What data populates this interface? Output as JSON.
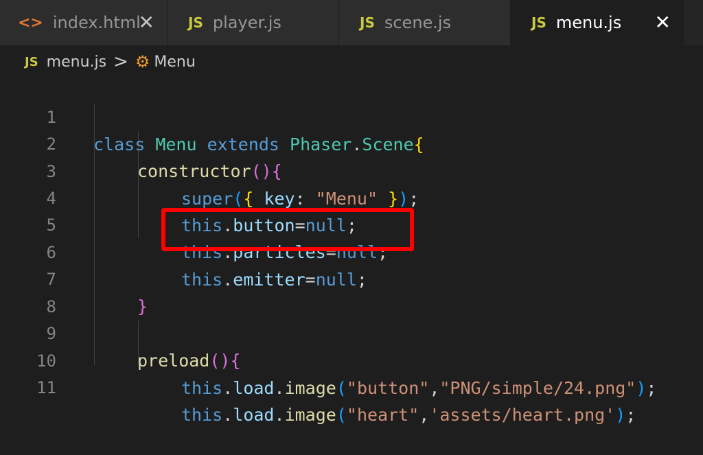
{
  "tabs": [
    {
      "icon": "html-icon",
      "glyph": "<>",
      "label": "index.html",
      "close": "✕"
    },
    {
      "icon": "js-icon",
      "glyph": "JS",
      "label": "player.js"
    },
    {
      "icon": "js-icon",
      "glyph": "JS",
      "label": "scene.js"
    },
    {
      "icon": "js-icon",
      "glyph": "JS",
      "label": "menu.js",
      "close": "✕",
      "active": true
    }
  ],
  "breadcrumb": {
    "file_glyph": "JS",
    "file": "menu.js",
    "separator": ">",
    "symbol_glyph": "⚙",
    "symbol": "Menu"
  },
  "lines": [
    {
      "n": "1"
    },
    {
      "n": "2"
    },
    {
      "n": "3"
    },
    {
      "n": "4"
    },
    {
      "n": "5"
    },
    {
      "n": "6"
    },
    {
      "n": "7"
    },
    {
      "n": "8"
    },
    {
      "n": "9"
    },
    {
      "n": "10"
    },
    {
      "n": "11"
    }
  ],
  "code": {
    "l1": {
      "kw": "class",
      "name": "Menu",
      "ext": "extends",
      "base": "Phaser",
      "dot": ".",
      "scene": "Scene",
      "brace": "{"
    },
    "l2": {
      "fn": "constructor",
      "paren": "()",
      "brace": "{"
    },
    "l3": {
      "kw": "super",
      "p1": "(",
      "b": "{",
      "key": " key",
      "colon": ": ",
      "str": "\"Menu\"",
      "b2": " }",
      "p2": ")",
      "semi": ";"
    },
    "l4": {
      "kw": "this",
      "dot": ".",
      "prop": "button",
      "eq": "=",
      "nul": "null",
      "semi": ";"
    },
    "l5": {
      "kw": "this",
      "dot": ".",
      "prop": "particles",
      "eq": "=",
      "nul": "null",
      "semi": ";"
    },
    "l6": {
      "kw": "this",
      "dot": ".",
      "prop": "emitter",
      "eq": "=",
      "nul": "null",
      "semi": ";"
    },
    "l7": {
      "brace": "}"
    },
    "l9": {
      "fn": "preload",
      "paren": "()",
      "brace": "{"
    },
    "l10": {
      "kw": "this",
      "dot1": ".",
      "load": "load",
      "dot2": ".",
      "fn": "image",
      "p1": "(",
      "s1": "\"button\"",
      "comma": ",",
      "s2": "\"PNG/simple/24.png\"",
      "p2": ")",
      "semi": ";"
    },
    "l11": {
      "kw": "this",
      "dot1": ".",
      "load": "load",
      "dot2": ".",
      "fn": "image",
      "p1": "(",
      "s1": "\"heart\"",
      "comma": ",",
      "s2": "'assets/heart.png'",
      "p2": ")",
      "semi": ";"
    }
  },
  "colors": {
    "highlight_box": "#ff0000",
    "editor_bg": "#1e1e1e"
  }
}
